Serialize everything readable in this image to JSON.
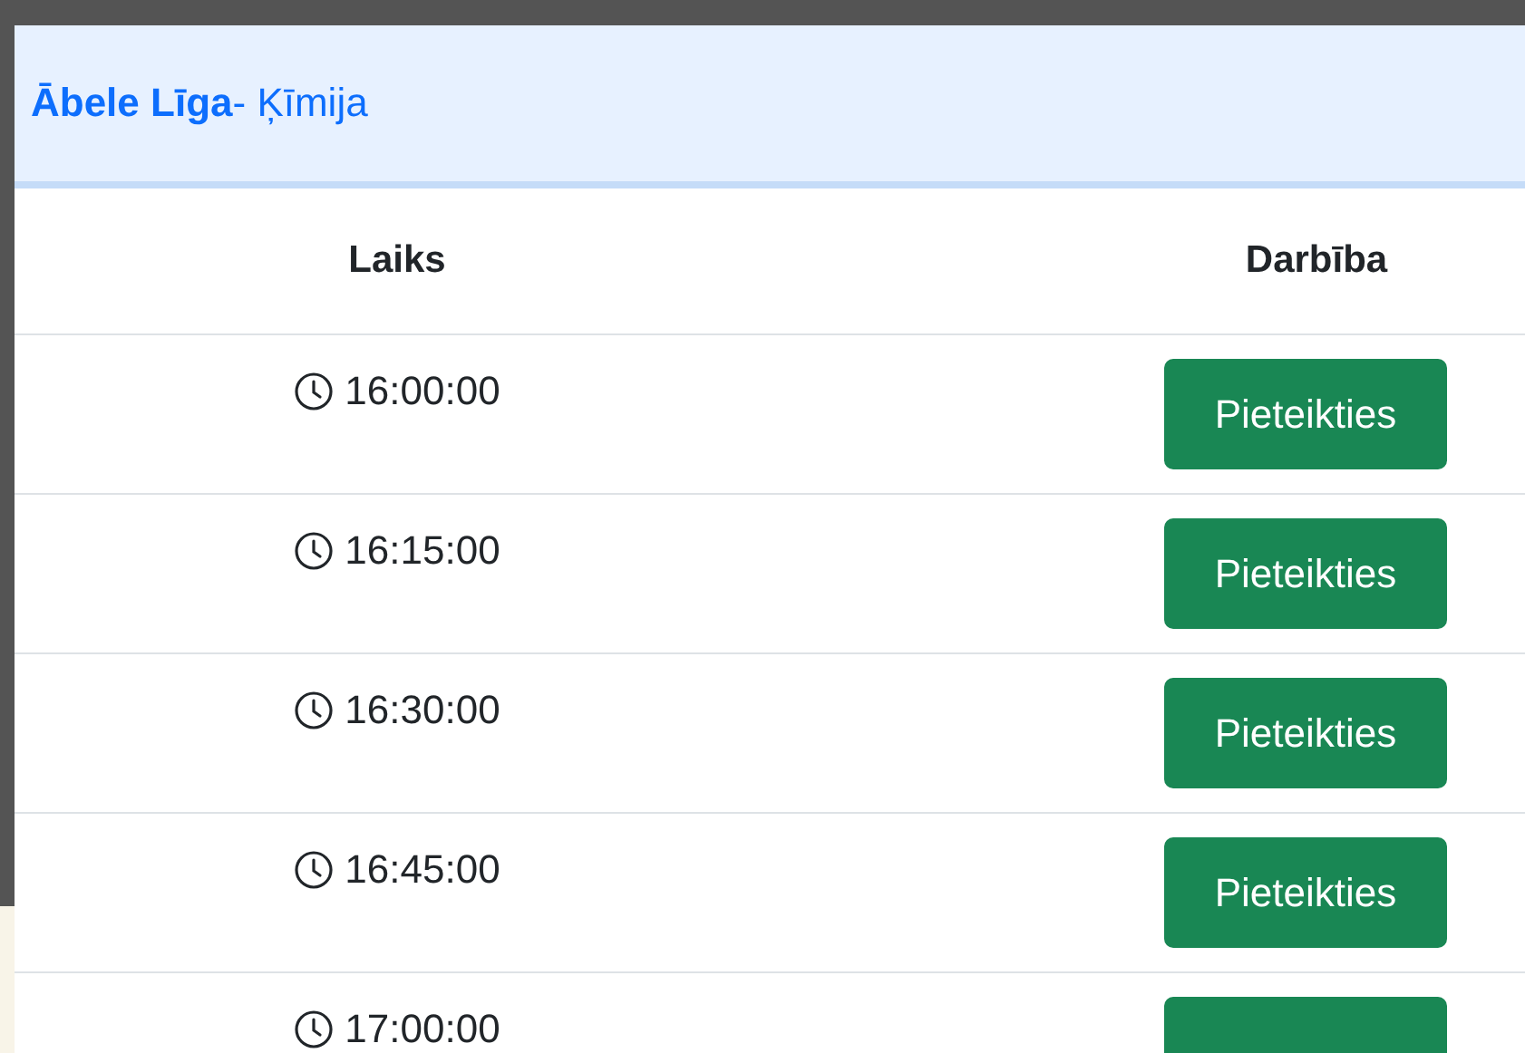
{
  "header": {
    "name": "Ābele Līga",
    "subject": "- Ķīmija"
  },
  "table": {
    "columns": [
      "Laiks",
      "Darbība"
    ],
    "rows": [
      {
        "time": "16:00:00",
        "action": "Pieteikties"
      },
      {
        "time": "16:15:00",
        "action": "Pieteikties"
      },
      {
        "time": "16:30:00",
        "action": "Pieteikties"
      },
      {
        "time": "16:45:00",
        "action": "Pieteikties"
      },
      {
        "time": "17:00:00"
      }
    ]
  }
}
